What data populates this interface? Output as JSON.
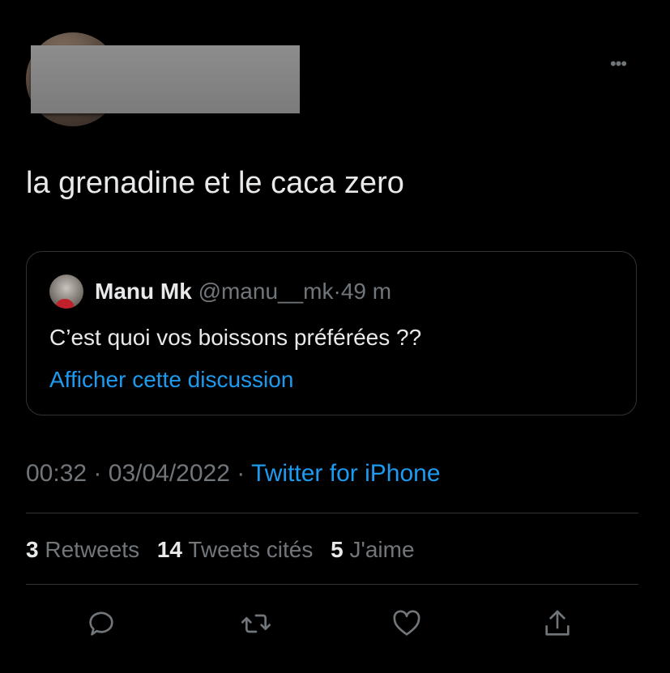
{
  "tweet": {
    "text": "la grenadine et le caca zero",
    "more_icon": "more-horizontal-icon",
    "time": "00:32",
    "date": "03/04/2022",
    "source": "Twitter for iPhone",
    "sep": "·"
  },
  "quote": {
    "name": "Manu Mk",
    "handle": "@manu__mk",
    "age": "49 m",
    "text": "C’est quoi vos boissons préférées ??",
    "link": "Afficher cette discussion"
  },
  "stats": {
    "retweets_count": "3",
    "retweets_label": "Retweets",
    "quotes_count": "14",
    "quotes_label": "Tweets cités",
    "likes_count": "5",
    "likes_label": "J'aime"
  },
  "actions": [
    "reply-icon",
    "retweet-icon",
    "like-icon",
    "share-icon"
  ],
  "colors": {
    "background": "#000000",
    "accent": "#1d9bf0",
    "muted": "#71767b",
    "border": "#2f3336"
  }
}
